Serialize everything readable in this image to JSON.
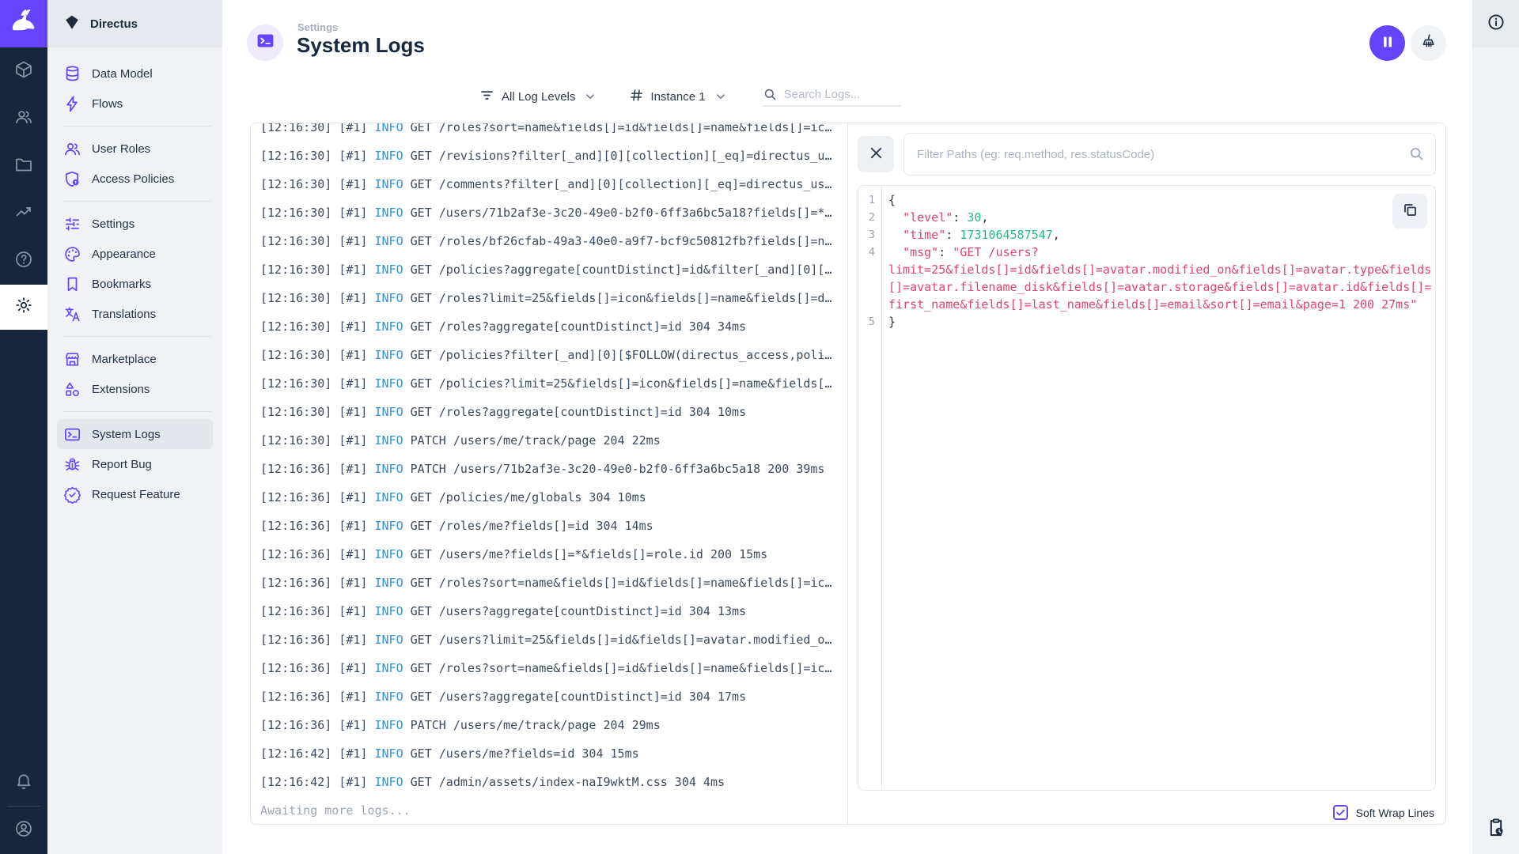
{
  "app": {
    "project_name": "Directus"
  },
  "colors": {
    "accent": "#6644ff",
    "rail_bg": "#16263c",
    "sidebar_bg": "#f0f2f5",
    "info_blue": "#2f94e4",
    "code_red": "#e0456c",
    "code_green": "#26ba82"
  },
  "rail": {
    "icons": [
      "directus-rabbit-logo",
      "box",
      "users",
      "folder",
      "insights",
      "help",
      "settings-active",
      "bell",
      "account"
    ]
  },
  "sidebar": {
    "project_name": "Directus",
    "sections": [
      [
        {
          "label": "Data Model",
          "icon": "database"
        },
        {
          "label": "Flows",
          "icon": "bolt"
        }
      ],
      [
        {
          "label": "User Roles",
          "icon": "people"
        },
        {
          "label": "Access Policies",
          "icon": "shield"
        }
      ],
      [
        {
          "label": "Settings",
          "icon": "tune"
        },
        {
          "label": "Appearance",
          "icon": "palette"
        },
        {
          "label": "Bookmarks",
          "icon": "bookmark"
        },
        {
          "label": "Translations",
          "icon": "translate"
        }
      ],
      [
        {
          "label": "Marketplace",
          "icon": "storefront"
        },
        {
          "label": "Extensions",
          "icon": "category"
        }
      ],
      [
        {
          "label": "System Logs",
          "icon": "terminal",
          "active": true
        },
        {
          "label": "Report Bug",
          "icon": "bug"
        },
        {
          "label": "Request Feature",
          "icon": "verified"
        }
      ]
    ]
  },
  "header": {
    "breadcrumb": "Settings",
    "title": "System Logs"
  },
  "filters": {
    "log_levels_label": "All Log Levels",
    "instance_label": "Instance 1",
    "search_placeholder": "Search Logs..."
  },
  "logs": {
    "awaiting": "Awaiting more logs...",
    "rows": [
      {
        "time": "[12:16:30]",
        "pid": "[#1]",
        "level": "INFO",
        "msg": "GET /roles?sort=name&fields[]=id&fields[]=name&fields[]=ic…"
      },
      {
        "time": "[12:16:30]",
        "pid": "[#1]",
        "level": "INFO",
        "msg": "GET /revisions?filter[_and][0][collection][_eq]=directus_u…"
      },
      {
        "time": "[12:16:30]",
        "pid": "[#1]",
        "level": "INFO",
        "msg": "GET /comments?filter[_and][0][collection][_eq]=directus_us…"
      },
      {
        "time": "[12:16:30]",
        "pid": "[#1]",
        "level": "INFO",
        "msg": "GET /users/71b2af3e-3c20-49e0-b2f0-6ff3a6bc5a18?fields[]=*…"
      },
      {
        "time": "[12:16:30]",
        "pid": "[#1]",
        "level": "INFO",
        "msg": "GET /roles/bf26cfab-49a3-40e0-a9f7-bcf9c50812fb?fields[]=n…"
      },
      {
        "time": "[12:16:30]",
        "pid": "[#1]",
        "level": "INFO",
        "msg": "GET /policies?aggregate[countDistinct]=id&filter[_and][0][…"
      },
      {
        "time": "[12:16:30]",
        "pid": "[#1]",
        "level": "INFO",
        "msg": "GET /roles?limit=25&fields[]=icon&fields[]=name&fields[]=d…"
      },
      {
        "time": "[12:16:30]",
        "pid": "[#1]",
        "level": "INFO",
        "msg": "GET /roles?aggregate[countDistinct]=id 304 34ms"
      },
      {
        "time": "[12:16:30]",
        "pid": "[#1]",
        "level": "INFO",
        "msg": "GET /policies?filter[_and][0][$FOLLOW(directus_access,poli…"
      },
      {
        "time": "[12:16:30]",
        "pid": "[#1]",
        "level": "INFO",
        "msg": "GET /policies?limit=25&fields[]=icon&fields[]=name&fields[…"
      },
      {
        "time": "[12:16:30]",
        "pid": "[#1]",
        "level": "INFO",
        "msg": "GET /roles?aggregate[countDistinct]=id 304 10ms"
      },
      {
        "time": "[12:16:30]",
        "pid": "[#1]",
        "level": "INFO",
        "msg": "PATCH /users/me/track/page 204 22ms"
      },
      {
        "time": "[12:16:36]",
        "pid": "[#1]",
        "level": "INFO",
        "msg": "PATCH /users/71b2af3e-3c20-49e0-b2f0-6ff3a6bc5a18 200 39ms"
      },
      {
        "time": "[12:16:36]",
        "pid": "[#1]",
        "level": "INFO",
        "msg": "GET /policies/me/globals 304 10ms"
      },
      {
        "time": "[12:16:36]",
        "pid": "[#1]",
        "level": "INFO",
        "msg": "GET /roles/me?fields[]=id 304 14ms"
      },
      {
        "time": "[12:16:36]",
        "pid": "[#1]",
        "level": "INFO",
        "msg": "GET /users/me?fields[]=*&fields[]=role.id 200 15ms"
      },
      {
        "time": "[12:16:36]",
        "pid": "[#1]",
        "level": "INFO",
        "msg": "GET /roles?sort=name&fields[]=id&fields[]=name&fields[]=ic…"
      },
      {
        "time": "[12:16:36]",
        "pid": "[#1]",
        "level": "INFO",
        "msg": "GET /users?aggregate[countDistinct]=id 304 13ms"
      },
      {
        "time": "[12:16:36]",
        "pid": "[#1]",
        "level": "INFO",
        "msg": "GET /users?limit=25&fields[]=id&fields[]=avatar.modified_o…"
      },
      {
        "time": "[12:16:36]",
        "pid": "[#1]",
        "level": "INFO",
        "msg": "GET /roles?sort=name&fields[]=id&fields[]=name&fields[]=ic…"
      },
      {
        "time": "[12:16:36]",
        "pid": "[#1]",
        "level": "INFO",
        "msg": "GET /users?aggregate[countDistinct]=id 304 17ms"
      },
      {
        "time": "[12:16:36]",
        "pid": "[#1]",
        "level": "INFO",
        "msg": "PATCH /users/me/track/page 204 29ms"
      },
      {
        "time": "[12:16:42]",
        "pid": "[#1]",
        "level": "INFO",
        "msg": "GET /users/me?fields=id 304 15ms"
      },
      {
        "time": "[12:16:42]",
        "pid": "[#1]",
        "level": "INFO",
        "msg": "GET /admin/assets/index-naI9wktM.css 304 4ms"
      }
    ]
  },
  "detail": {
    "filter_placeholder": "Filter Paths (eg: req.method, res.statusCode)",
    "soft_wrap_label": "Soft Wrap Lines",
    "soft_wrap_checked": true,
    "code": {
      "lines": [
        {
          "num": "1",
          "tokens": [
            {
              "c": "p",
              "t": "{"
            }
          ]
        },
        {
          "num": "2",
          "tokens": [
            {
              "c": "p",
              "t": "  "
            },
            {
              "c": "k",
              "t": "\"level\""
            },
            {
              "c": "p",
              "t": ": "
            },
            {
              "c": "n",
              "t": "30"
            },
            {
              "c": "p",
              "t": ","
            }
          ]
        },
        {
          "num": "3",
          "tokens": [
            {
              "c": "p",
              "t": "  "
            },
            {
              "c": "k",
              "t": "\"time\""
            },
            {
              "c": "p",
              "t": ": "
            },
            {
              "c": "n",
              "t": "1731064587547"
            },
            {
              "c": "p",
              "t": ","
            }
          ]
        },
        {
          "num": "4",
          "tokens": [
            {
              "c": "p",
              "t": "  "
            },
            {
              "c": "k",
              "t": "\"msg\""
            },
            {
              "c": "p",
              "t": ": "
            },
            {
              "c": "s",
              "t": "\"GET /users?"
            }
          ]
        },
        {
          "num": "",
          "tokens": [
            {
              "c": "s",
              "t": "limit=25&fields[]=id&fields[]=avatar.modified_on&fields[]=avatar.type&fields"
            }
          ]
        },
        {
          "num": "",
          "tokens": [
            {
              "c": "s",
              "t": "[]=avatar.filename_disk&fields[]=avatar.storage&fields[]=avatar.id&fields[]="
            }
          ]
        },
        {
          "num": "",
          "tokens": [
            {
              "c": "s",
              "t": "first_name&fields[]=last_name&fields[]=email&sort[]=email&page=1 200 27ms\""
            }
          ]
        },
        {
          "num": "5",
          "tokens": [
            {
              "c": "p",
              "t": "}"
            }
          ]
        }
      ]
    }
  }
}
